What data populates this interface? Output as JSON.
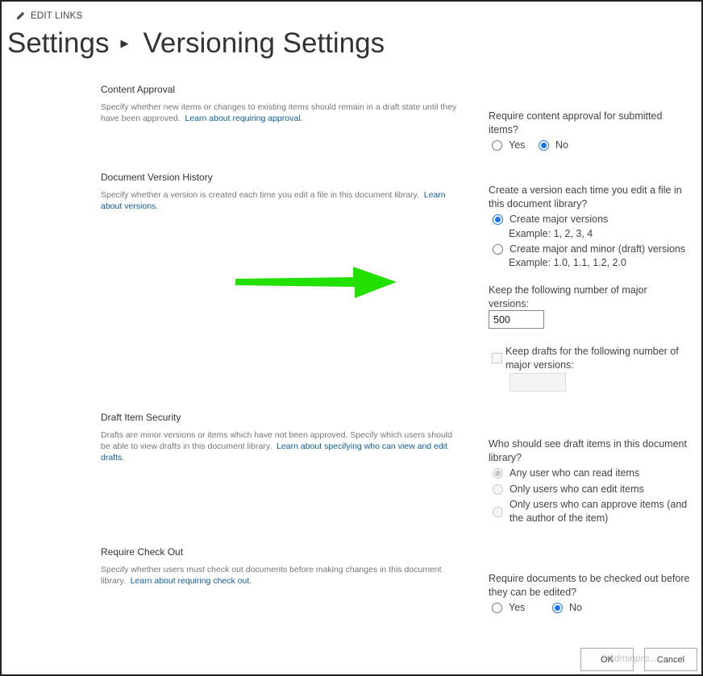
{
  "header": {
    "edit_links": "EDIT LINKS",
    "title_parent": "Settings",
    "title_current": "Versioning Settings"
  },
  "content_approval": {
    "title": "Content Approval",
    "desc": "Specify whether new items or changes to existing items should remain in a draft state until they have been approved.",
    "link": "Learn about requiring approval.",
    "question": "Require content approval for submitted items?",
    "yes": "Yes",
    "no": "No",
    "selected": "No"
  },
  "version_history": {
    "title": "Document Version History",
    "desc": "Specify whether a version is created each time you edit a file in this document library.",
    "link": "Learn about versions.",
    "question": "Create a version each time you edit a file in this document library?",
    "opt_major": "Create major versions",
    "opt_major_example": "Example: 1, 2, 3, 4",
    "opt_minor": "Create major and minor (draft) versions",
    "opt_minor_example": "Example: 1.0, 1.1, 1.2, 2.0",
    "selected": "Create major versions",
    "keep_major_label": "Keep the following number of major versions:",
    "keep_major_value": "500",
    "keep_drafts_label": "Keep drafts for the following number of major versions:",
    "keep_drafts_value": ""
  },
  "draft_security": {
    "title": "Draft Item Security",
    "desc": "Drafts are minor versions or items which have not been approved. Specify which users should be able to view drafts in this document library.",
    "link": "Learn about specifying who can view and edit drafts.",
    "question": "Who should see draft items in this document library?",
    "opt_read": "Any user who can read items",
    "opt_edit": "Only users who can edit items",
    "opt_approve": "Only users who can approve items (and the author of the item)",
    "selected": "Any user who can read items"
  },
  "check_out": {
    "title": "Require Check Out",
    "desc": "Specify whether users must check out documents before making changes in this document library.",
    "link": "Learn about requiring check out.",
    "question": "Require documents to be checked out before they can be edited?",
    "yes": "Yes",
    "no": "No",
    "selected": "No"
  },
  "buttons": {
    "ok": "OK",
    "cancel": "Cancel"
  },
  "watermark": "©Adminpro...",
  "colors": {
    "accent": "#1a73e8",
    "link": "#0f5c9e",
    "arrow": "#22e000"
  }
}
